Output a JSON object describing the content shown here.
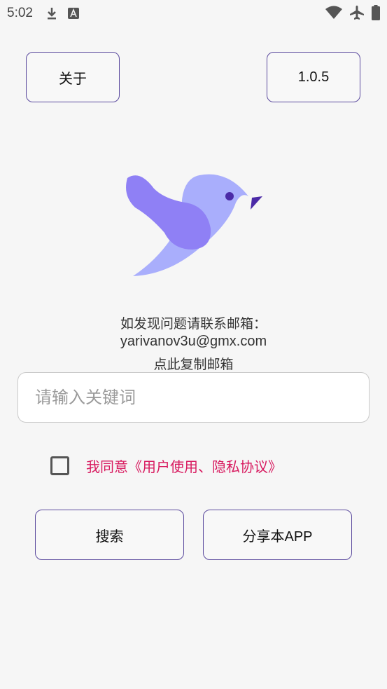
{
  "status_bar": {
    "time": "5:02",
    "icons": [
      "download-icon",
      "a-icon",
      "wifi-icon",
      "airplane-icon",
      "battery-icon"
    ]
  },
  "top_buttons": {
    "about_label": "关于",
    "version_label": "1.0.5"
  },
  "contact": {
    "line1": "如发现问题请联系邮箱：",
    "email": "yarivanov3u@gmx.com",
    "copy_hint": "点此复制邮箱"
  },
  "search": {
    "placeholder": "请输入关键词",
    "value": ""
  },
  "agreement": {
    "checked": false,
    "label": "我同意《用户使用、隐私协议》"
  },
  "bottom_buttons": {
    "search_label": "搜索",
    "share_label": "分享本APP"
  },
  "colors": {
    "accent_border": "#5b4a9e",
    "agreement_text": "#d81b60",
    "bird_body": "#a9aefc",
    "bird_wing": "#8f80f5",
    "bird_beak": "#4b2aa7"
  }
}
